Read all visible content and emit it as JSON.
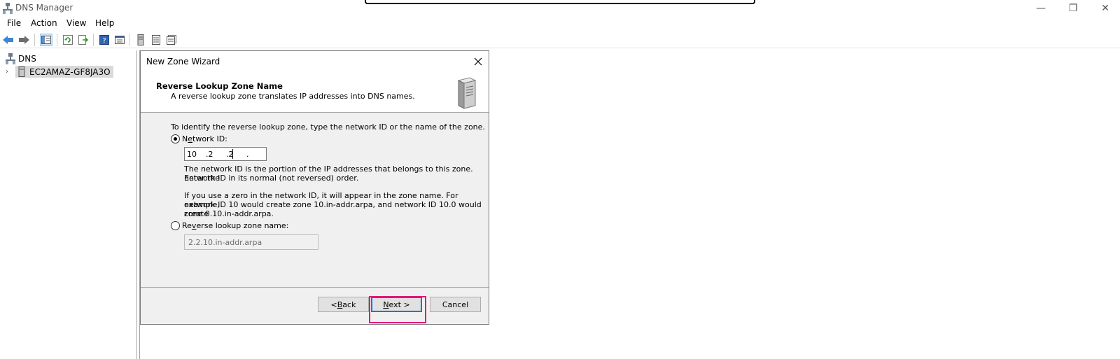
{
  "app": {
    "title": "DNS Manager"
  },
  "window_controls": {
    "minimize": "—",
    "restore": "❐",
    "close": "✕"
  },
  "menu": {
    "file": "File",
    "action": "Action",
    "view": "View",
    "help": "Help"
  },
  "tree": {
    "root": "DNS",
    "server": "EC2AMAZ-GF8JA3O"
  },
  "dialog": {
    "title": "New Zone Wizard",
    "header_title": "Reverse Lookup Zone Name",
    "header_subtitle": "A reverse lookup zone translates IP addresses into DNS names.",
    "instruction": "To identify the reverse lookup zone, type the network ID or the name of the zone.",
    "network_id_label_pre": "N",
    "network_id_label_u": "e",
    "network_id_label_post": "twork ID:",
    "network_id": {
      "seg1": "10",
      "seg2": ".2",
      "seg3": ".2",
      "seg4": "."
    },
    "para1_line1": "The network ID is the portion of the IP addresses that belongs to this zone. Enter the",
    "para1_line2": "network ID in its normal (not reversed) order.",
    "para2_line1": "If you use a zero in the network ID, it will appear in the zone name. For example,",
    "para2_line2": "network ID 10 would create zone 10.in-addr.arpa, and network ID 10.0 would create",
    "para2_line3": "zone 0.10.in-addr.arpa.",
    "reverse_label_pre": "Re",
    "reverse_label_u": "v",
    "reverse_label_post": "erse lookup zone name:",
    "reverse_zone_value": "2.2.10.in-addr.arpa",
    "back_pre": "< ",
    "back_u": "B",
    "back_post": "ack",
    "next_u": "N",
    "next_post": "ext >",
    "cancel": "Cancel"
  },
  "icons": {
    "back": "back-arrow-icon",
    "forward": "forward-arrow-icon",
    "console_tree": "show-console-tree-icon",
    "refresh": "refresh-icon",
    "export": "export-list-icon",
    "help": "help-icon",
    "properties": "properties-icon",
    "server": "server-icon"
  },
  "colors": {
    "highlight": "#e0157a",
    "accent": "#0078d7"
  }
}
